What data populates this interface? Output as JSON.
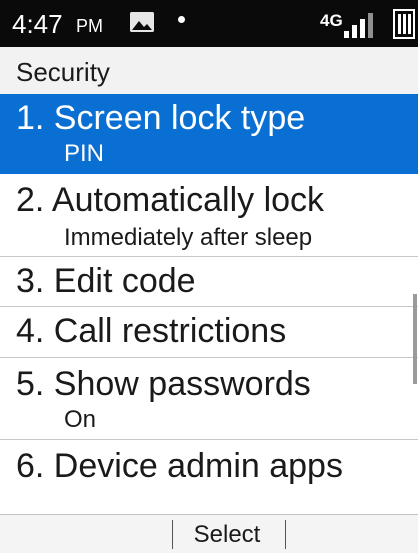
{
  "status_bar": {
    "time": "4:47",
    "ampm": "PM",
    "network": "4G",
    "icons": [
      "image-notification-icon",
      "notification-dot-icon",
      "signal-strength-icon",
      "battery-icon"
    ]
  },
  "app": {
    "title": "Security"
  },
  "menu": {
    "selected_index": 0,
    "items": [
      {
        "title": "1. Screen lock type",
        "subtitle": "PIN"
      },
      {
        "title": "2. Automatically lock",
        "subtitle": "Immediately after sleep"
      },
      {
        "title": "3. Edit code",
        "subtitle": ""
      },
      {
        "title": "4. Call restrictions",
        "subtitle": ""
      },
      {
        "title": "5. Show passwords",
        "subtitle": "On"
      },
      {
        "title": "6. Device admin apps",
        "subtitle": ""
      }
    ]
  },
  "softkeys": {
    "left": "",
    "center": "Select",
    "right": ""
  },
  "colors": {
    "status_bar_bg": "#0a0a0a",
    "selection": "#0a6fd2",
    "title_bar_bg": "#f2f2f2",
    "softkey_bg": "#f4f4f4"
  }
}
